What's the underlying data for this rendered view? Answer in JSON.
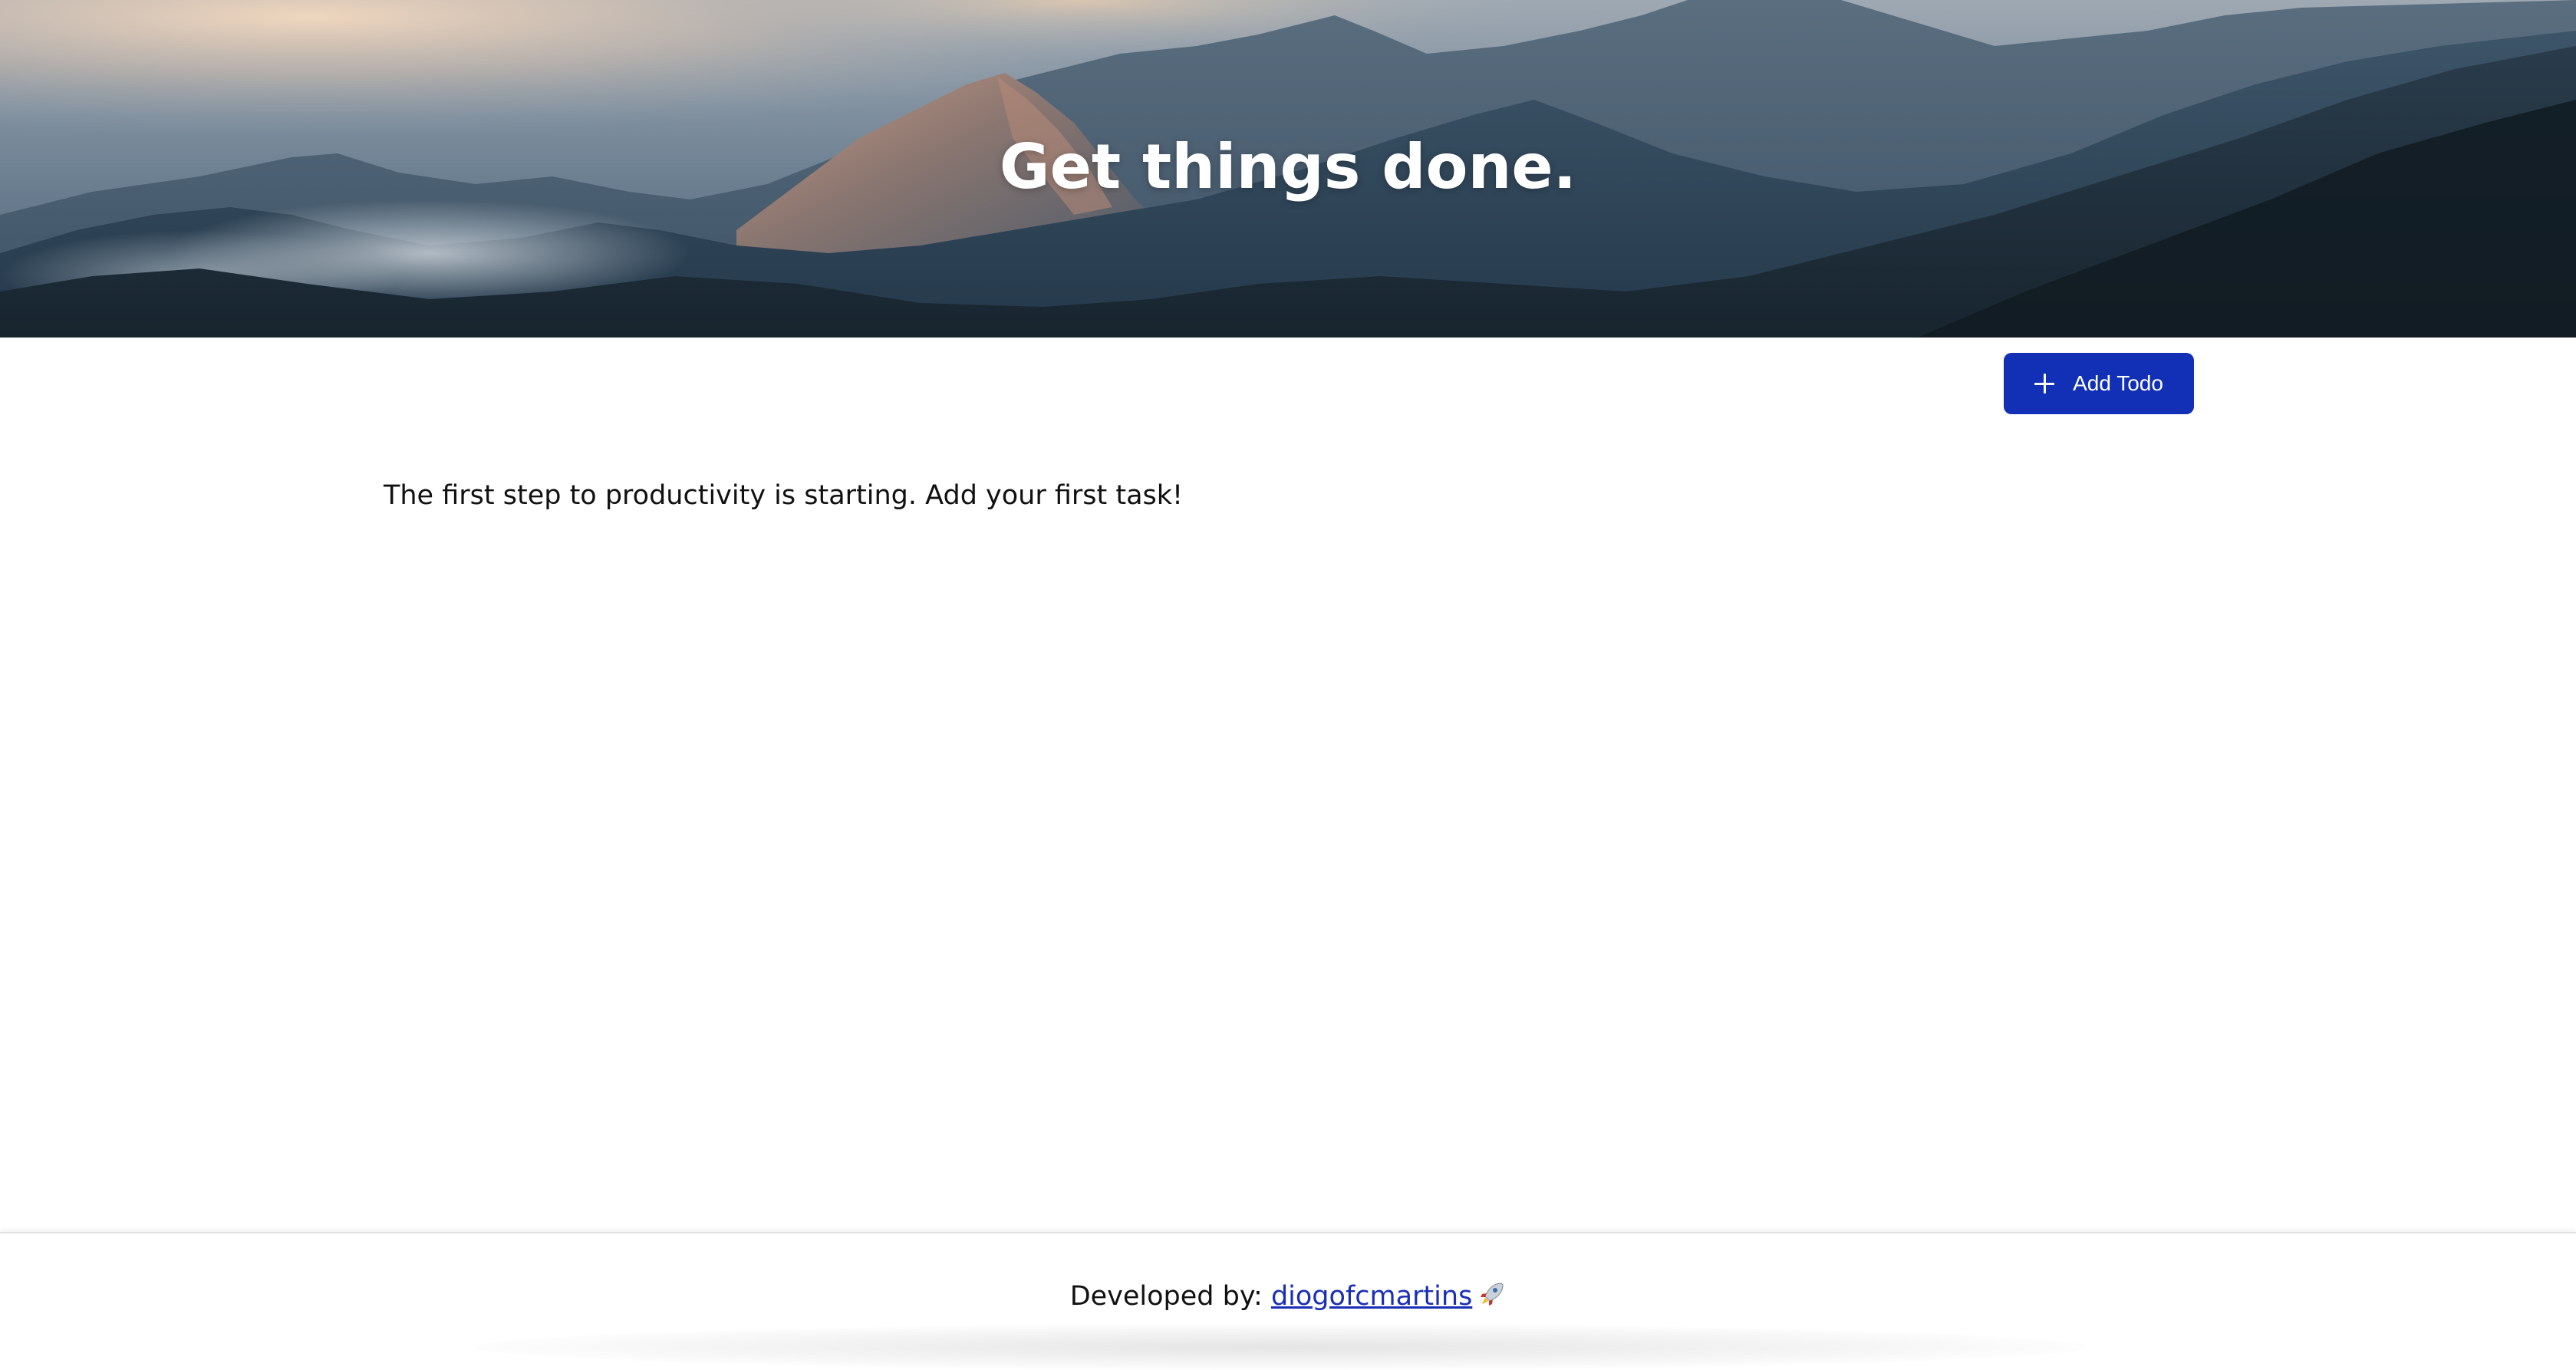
{
  "hero": {
    "title": "Get things done."
  },
  "toolbar": {
    "add_todo_label": "Add Todo"
  },
  "todos": {
    "empty_message": "The first step to productivity is starting. Add your first task!"
  },
  "footer": {
    "developed_by_label": "Developed by: ",
    "author_link_text": "diogofcmartins"
  },
  "colors": {
    "primary_button": "#1230b5",
    "link": "#1a2fb5"
  },
  "icons": {
    "add": "plus-icon",
    "footer_emoji": "rocket-icon"
  }
}
